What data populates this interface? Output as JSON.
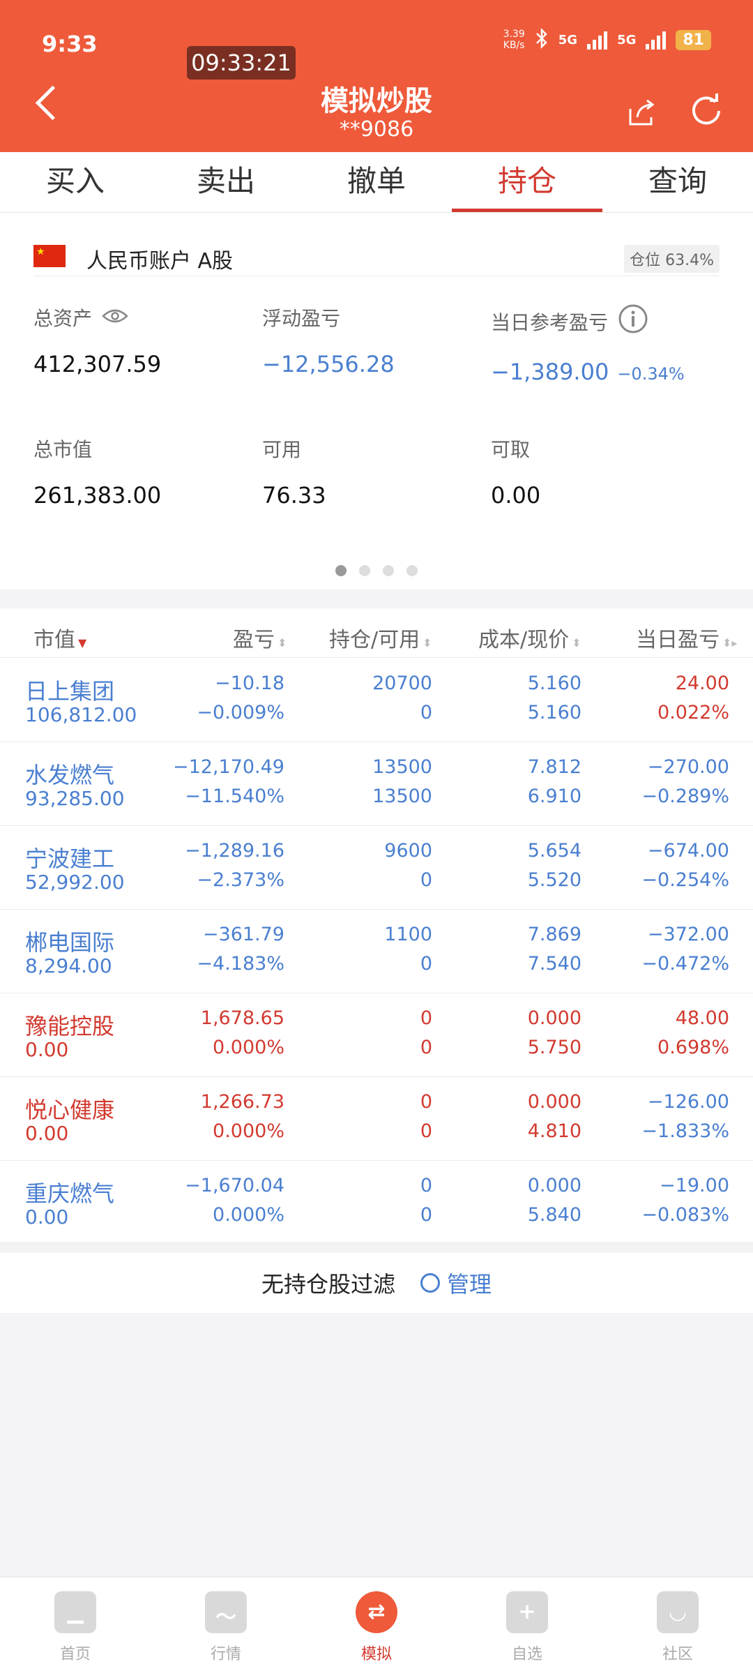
{
  "status": {
    "time": "9:33",
    "netspeed_value": "3.39",
    "netspeed_unit": "KB/s",
    "signal1": "5G",
    "signal2": "5G",
    "battery": "81"
  },
  "clock": "09:33:21",
  "header": {
    "title": "模拟炒股",
    "account_no": "**9086"
  },
  "tabs": [
    "买入",
    "卖出",
    "撤单",
    "持仓",
    "查询"
  ],
  "active_tab": 3,
  "account": {
    "name": "人民币账户 A股",
    "position_ratio": "仓位 63.4%",
    "total_assets_label": "总资产",
    "total_assets": "412,307.59",
    "floating_pl_label": "浮动盈亏",
    "floating_pl": "−12,556.28",
    "day_pl_label": "当日参考盈亏",
    "day_pl": "−1,389.00",
    "day_pl_pct": "−0.34%",
    "market_value_label": "总市值",
    "market_value": "261,383.00",
    "available_label": "可用",
    "available": "76.33",
    "withdrawable_label": "可取",
    "withdrawable": "0.00"
  },
  "table": {
    "headers": [
      "市值",
      "盈亏",
      "持仓/可用",
      "成本/现价",
      "当日盈亏"
    ],
    "rows": [
      {
        "name": "日上集团",
        "mv": "106,812.00",
        "pl": "−10.18",
        "pl_pct": "−0.009%",
        "pos": "20700",
        "avail": "0",
        "cost": "5.160",
        "price": "5.160",
        "day": "24.00",
        "day_pct": "0.022%",
        "cls": "blue",
        "day_cls": "red"
      },
      {
        "name": "水发燃气",
        "mv": "93,285.00",
        "pl": "−12,170.49",
        "pl_pct": "−11.540%",
        "pos": "13500",
        "avail": "13500",
        "cost": "7.812",
        "price": "6.910",
        "day": "−270.00",
        "day_pct": "−0.289%",
        "cls": "blue",
        "day_cls": "blue"
      },
      {
        "name": "宁波建工",
        "mv": "52,992.00",
        "pl": "−1,289.16",
        "pl_pct": "−2.373%",
        "pos": "9600",
        "avail": "0",
        "cost": "5.654",
        "price": "5.520",
        "day": "−674.00",
        "day_pct": "−0.254%",
        "cls": "blue",
        "day_cls": "blue"
      },
      {
        "name": "郴电国际",
        "mv": "8,294.00",
        "pl": "−361.79",
        "pl_pct": "−4.183%",
        "pos": "1100",
        "avail": "0",
        "cost": "7.869",
        "price": "7.540",
        "day": "−372.00",
        "day_pct": "−0.472%",
        "cls": "blue",
        "day_cls": "blue"
      },
      {
        "name": "豫能控股",
        "mv": "0.00",
        "pl": "1,678.65",
        "pl_pct": "0.000%",
        "pos": "0",
        "avail": "0",
        "cost": "0.000",
        "price": "5.750",
        "day": "48.00",
        "day_pct": "0.698%",
        "cls": "red",
        "day_cls": "red"
      },
      {
        "name": "悦心健康",
        "mv": "0.00",
        "pl": "1,266.73",
        "pl_pct": "0.000%",
        "pos": "0",
        "avail": "0",
        "cost": "0.000",
        "price": "4.810",
        "day": "−126.00",
        "day_pct": "−1.833%",
        "cls": "red",
        "day_cls": "blue"
      },
      {
        "name": "重庆燃气",
        "mv": "0.00",
        "pl": "−1,670.04",
        "pl_pct": "0.000%",
        "pos": "0",
        "avail": "0",
        "cost": "0.000",
        "price": "5.840",
        "day": "−19.00",
        "day_pct": "−0.083%",
        "cls": "blue",
        "day_cls": "blue"
      }
    ]
  },
  "filter": {
    "text": "无持仓股过滤",
    "manage": "管理"
  },
  "nav": [
    {
      "label": "首页",
      "icon": "home-icon"
    },
    {
      "label": "行情",
      "icon": "chart-icon"
    },
    {
      "label": "模拟",
      "icon": "exchange-icon"
    },
    {
      "label": "自选",
      "icon": "folder-add-icon"
    },
    {
      "label": "社区",
      "icon": "community-icon"
    }
  ],
  "nav_active": 2,
  "colors": {
    "brand": "#ee5a3a",
    "up": "#d23a30",
    "down": "#4a7fd0"
  }
}
